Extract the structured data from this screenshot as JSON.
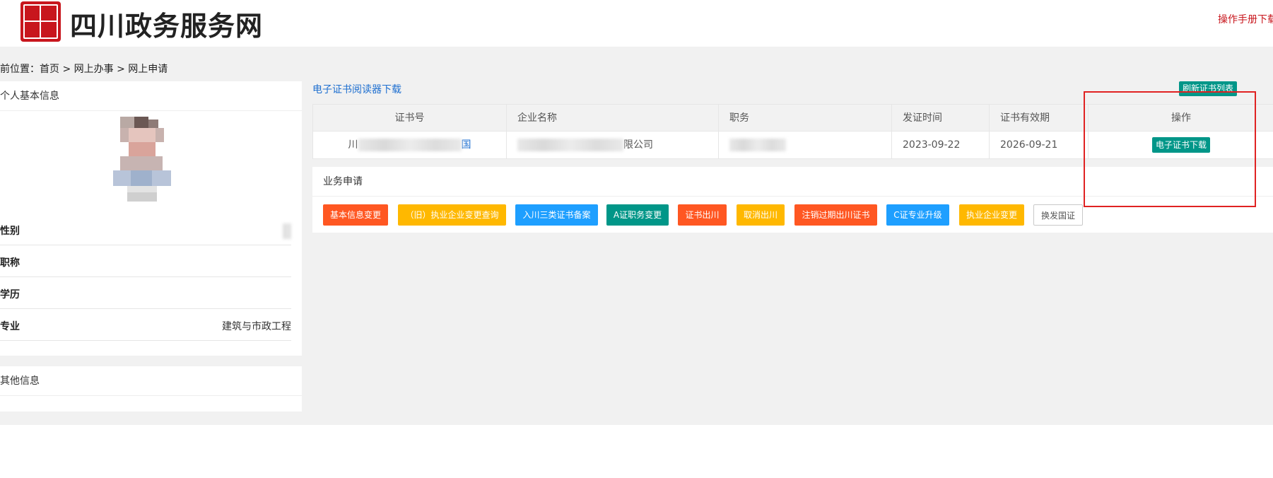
{
  "header": {
    "site_title": "四川政务服务网",
    "manual_link": "操作手册下载",
    "logo_icon": "sichuan-seal-logo"
  },
  "breadcrumb": "前位置：首页 > 网上办事 > 网上申请",
  "personal": {
    "title": "个人基本信息",
    "rows": [
      {
        "label": "性别",
        "value": ""
      },
      {
        "label": "职称",
        "value": ""
      },
      {
        "label": "学历",
        "value": ""
      },
      {
        "label": "专业",
        "value": "建筑与市政工程"
      }
    ]
  },
  "other": {
    "title": "其他信息"
  },
  "certificates": {
    "reader_link": "电子证书阅读器下载",
    "refresh_label": "刷新证书列表",
    "columns": [
      "证书号",
      "企业名称",
      "职务",
      "发证时间",
      "证书有效期",
      "操作"
    ],
    "rows": [
      {
        "cert_no_prefix": "川",
        "cert_no_suffix": "国",
        "company_suffix": "限公司",
        "position": "",
        "issue_date": "2023-09-22",
        "valid_until": "2026-09-21",
        "action": "电子证书下载"
      }
    ]
  },
  "business": {
    "title": "业务申请",
    "buttons": [
      {
        "label": "基本信息变更",
        "color": "#ff5722"
      },
      {
        "label": "（旧）执业企业变更查询",
        "color": "#ffb800"
      },
      {
        "label": "入川三类证书备案",
        "color": "#1e9fff"
      },
      {
        "label": "A证职务变更",
        "color": "#009688"
      },
      {
        "label": "证书出川",
        "color": "#ff5722"
      },
      {
        "label": "取消出川",
        "color": "#ffb800"
      },
      {
        "label": "注销过期出川证书",
        "color": "#ff5722"
      },
      {
        "label": "C证专业升级",
        "color": "#1e9fff"
      },
      {
        "label": "执业企业变更",
        "color": "#ffb800"
      },
      {
        "label": "换发国证",
        "color": "#ffffff"
      }
    ]
  }
}
